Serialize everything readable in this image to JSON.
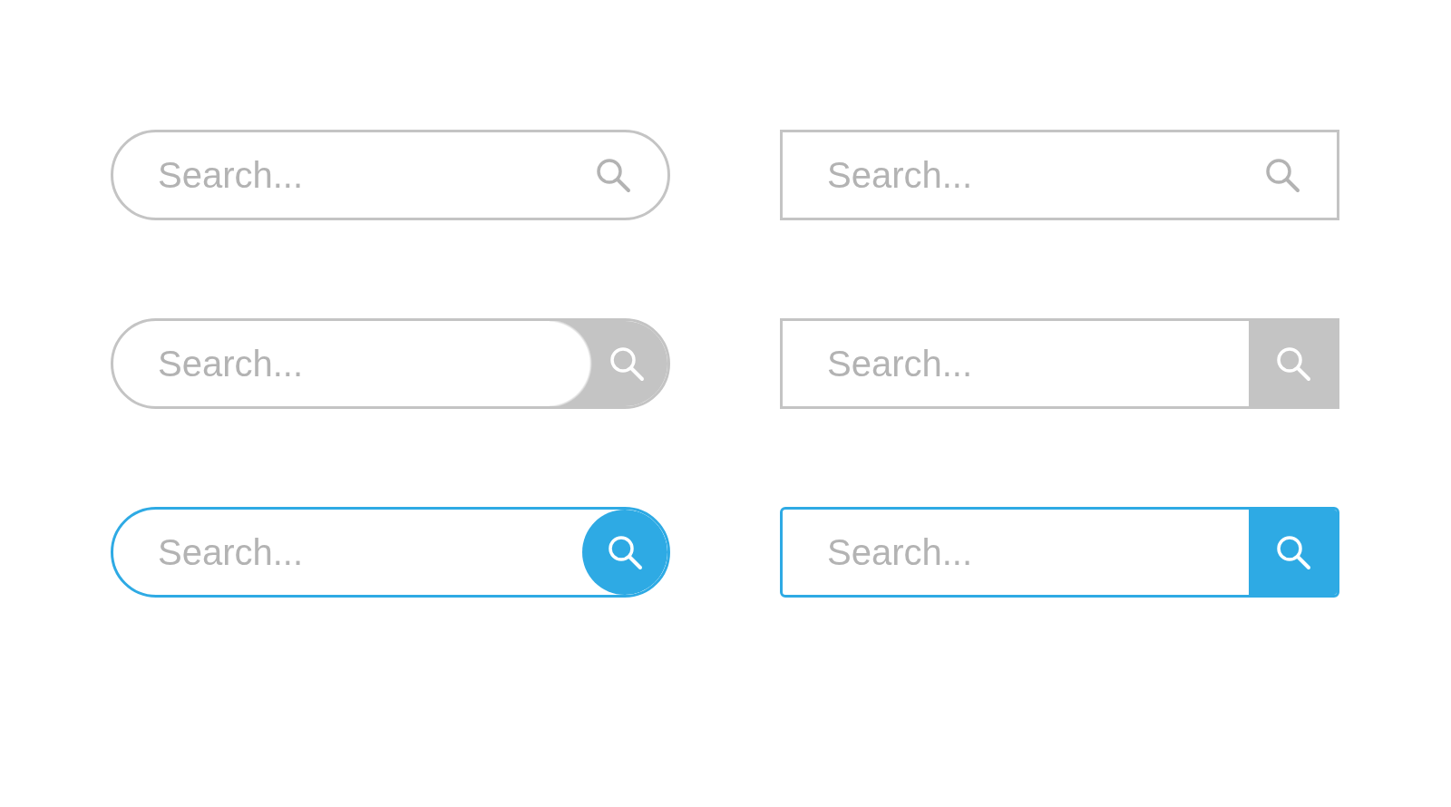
{
  "search_bars": [
    {
      "placeholder": "Search...",
      "kind": "round-icon"
    },
    {
      "placeholder": "Search...",
      "kind": "square-icon"
    },
    {
      "placeholder": "Search...",
      "kind": "round-gray-button"
    },
    {
      "placeholder": "Search...",
      "kind": "square-gray-button"
    },
    {
      "placeholder": "Search...",
      "kind": "round-blue-button"
    },
    {
      "placeholder": "Search...",
      "kind": "square-blue-button"
    }
  ]
}
